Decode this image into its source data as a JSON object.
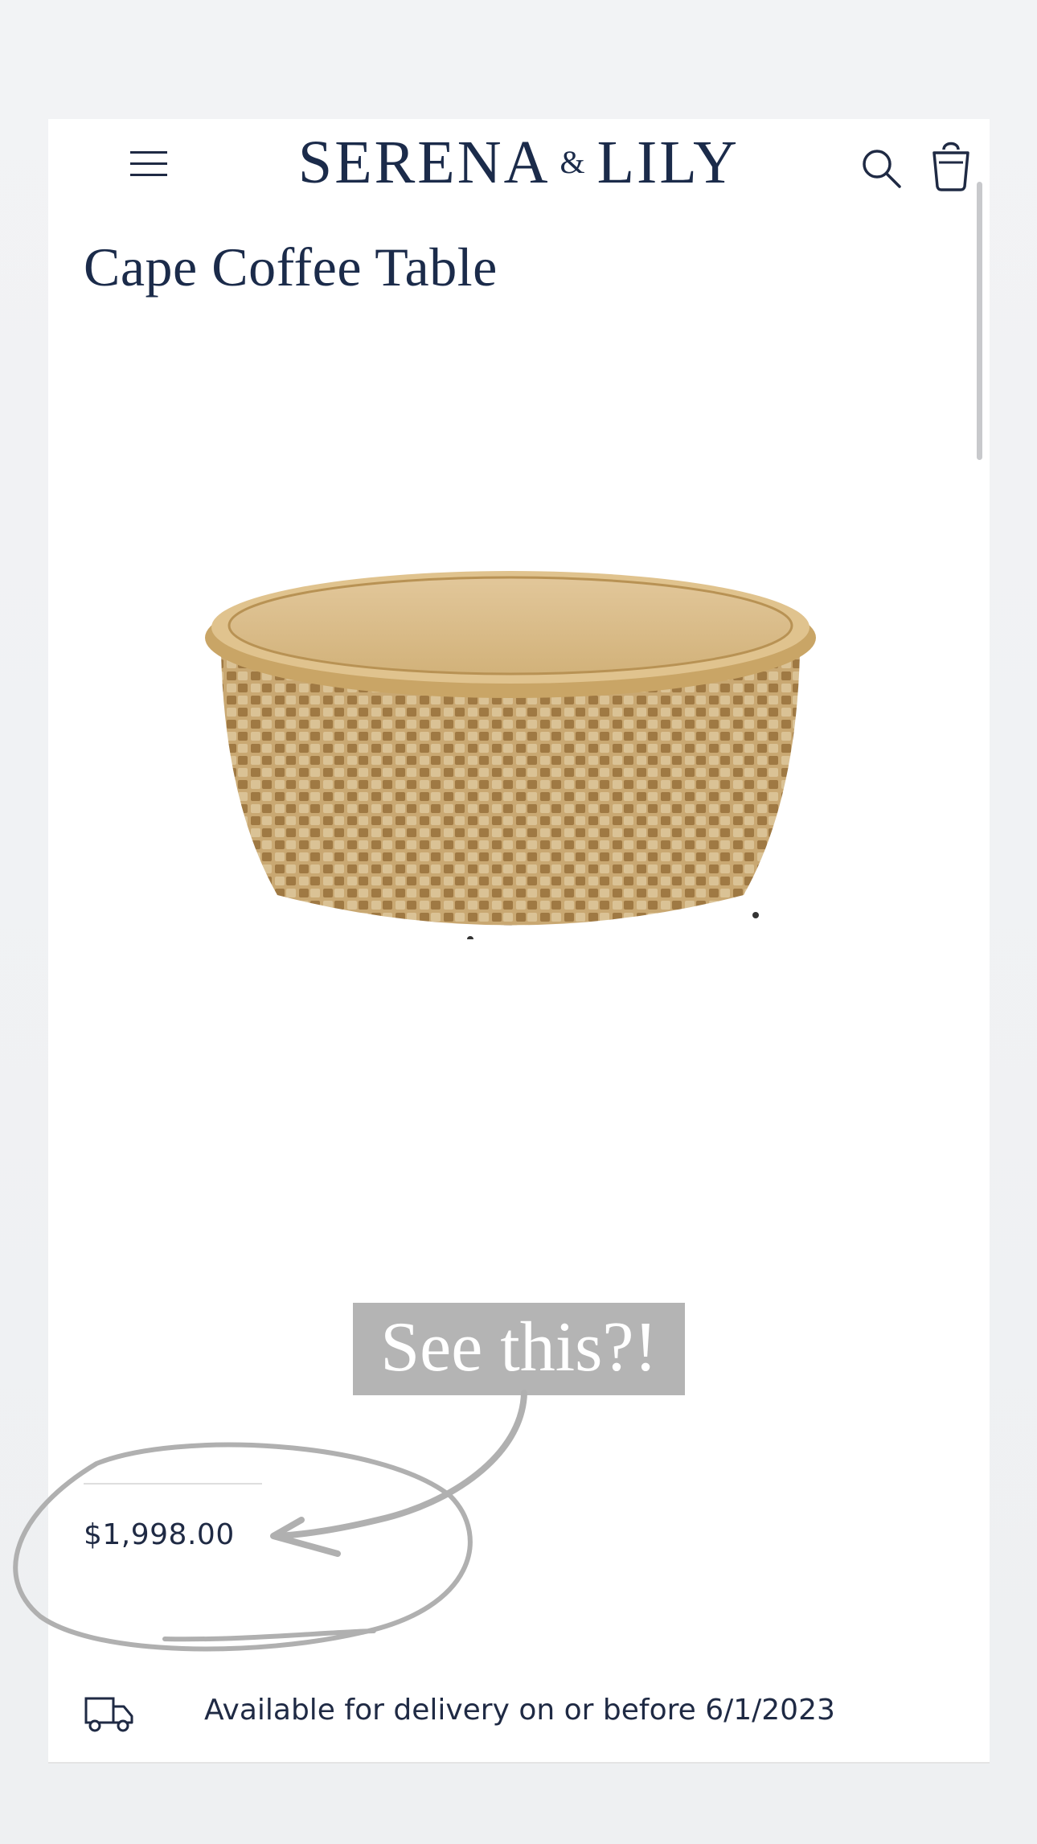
{
  "brand": {
    "name_left": "SERENA",
    "ampersand": "&",
    "name_right": "LILY"
  },
  "header": {
    "menu_icon": "hamburger-menu-icon",
    "search_icon": "search-icon",
    "bag_icon": "shopping-bag-icon"
  },
  "product": {
    "title": "Cape Coffee Table",
    "price": "$1,998.00",
    "image_description_icon": "rattan-round-coffee-table-image"
  },
  "annotation": {
    "caption": "See this?!",
    "caption_bg": "#b4b4b4",
    "stroke_color": "#b0b0b0"
  },
  "delivery": {
    "icon": "delivery-truck-icon",
    "text": "Available for delivery on or before 6/1/2023"
  },
  "colors": {
    "navy": "#1b2b4a",
    "text": "#1f2a44"
  }
}
